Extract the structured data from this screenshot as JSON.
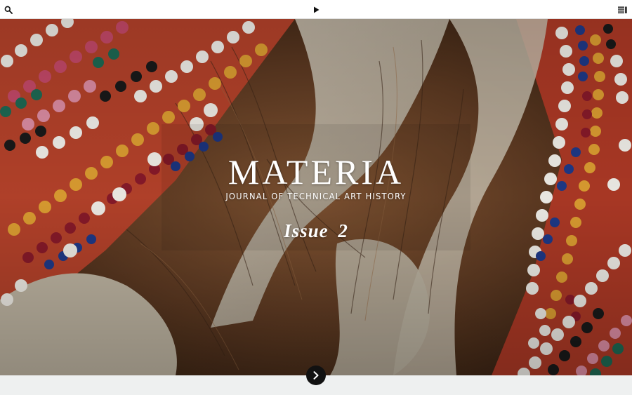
{
  "topbar": {
    "search_icon": "search-icon",
    "play_icon": "play-icon",
    "menu_icon": "menu-list-icon"
  },
  "hero": {
    "title": "MATERIA",
    "subtitle": "JOURNAL OF TECHNICAL ART HISTORY",
    "issue": "Issue 2"
  },
  "navigation": {
    "next_icon": "chevron-right-icon"
  },
  "colors": {
    "accent_dark": "#111111",
    "topbar_bg": "#ffffff",
    "page_bg": "#eef0f0"
  }
}
